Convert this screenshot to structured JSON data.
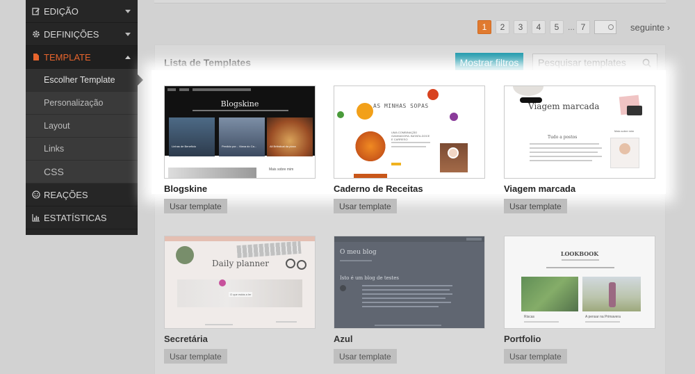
{
  "sidebar": {
    "sections": [
      {
        "label": "EDIÇÃO",
        "icon": "pencil-icon",
        "has_caret": true
      },
      {
        "label": "DEFINIÇÕES",
        "icon": "gear-icon",
        "has_caret": true
      },
      {
        "label": "TEMPLATE",
        "icon": "file-icon",
        "has_caret": true,
        "active": true
      }
    ],
    "template_sub": [
      "Escolher Template",
      "Personalização",
      "Layout",
      "Links",
      "CSS"
    ],
    "selected_sub": "Escolher Template",
    "bottom_sections": [
      {
        "label": "REAÇÕES",
        "icon": "smiley-icon"
      },
      {
        "label": "ESTATÍSTICAS",
        "icon": "bar-chart-icon"
      }
    ]
  },
  "pagination": {
    "pages": [
      "1",
      "2",
      "3",
      "4",
      "5",
      "...",
      "7"
    ],
    "current": "1",
    "next_label": "seguinte ›"
  },
  "panel": {
    "title": "Lista de Templates",
    "filter_button": "Mostrar filtros",
    "search_placeholder": "Pesquisar templates"
  },
  "templates": [
    {
      "name": "Blogskine",
      "button": "Usar template",
      "thumb_title": "Blogskine",
      "captions": [
        "Linhas de Benefício",
        "Perdido por... Viana do Ca...",
        "All Britistical da pizza"
      ],
      "sidebar_text": "Mais sobre mim"
    },
    {
      "name": "Caderno de Receitas",
      "button": "Usar template",
      "thumb_title": "AS MINHAS SOPAS",
      "post_title": "UMA COMBINAÇÃO GANHADORA: BATATA-DOCE E CARRESO"
    },
    {
      "name": "Viagem marcada",
      "button": "Usar template",
      "thumb_title": "Viagem marcada",
      "post_title": "Tudo a postos",
      "sidebar_text": "Mais sobre mim"
    },
    {
      "name": "Secretária",
      "button": "Usar template",
      "thumb_title": "Daily planner",
      "caption": "O que estás a ler"
    },
    {
      "name": "Azul",
      "button": "Usar template",
      "thumb_title": "O meu blog",
      "post_title": "Isto é um blog de testes"
    },
    {
      "name": "Portfolio",
      "button": "Usar template",
      "thumb_title": "LOOKBOOK",
      "captions": [
        "Riscas",
        "A pensar na Primavera"
      ]
    }
  ],
  "colors": {
    "accent_orange": "#e8652d",
    "page_current": "#e07a2f",
    "filter_teal": "#1595a8",
    "sidebar_bg": "#262626"
  }
}
